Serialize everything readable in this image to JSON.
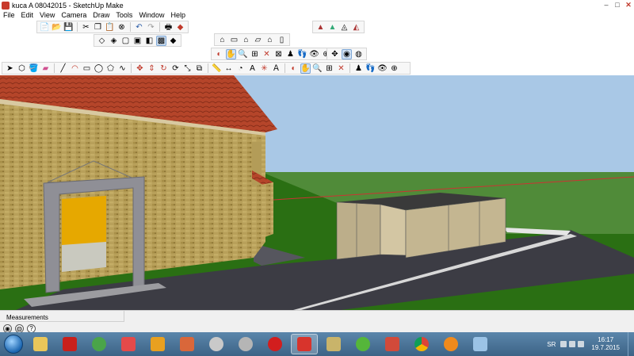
{
  "window": {
    "title": "kuca A 08042015 - SketchUp Make",
    "minimize": "–",
    "maximize": "□",
    "close": "✕"
  },
  "menu": {
    "items": [
      "File",
      "Edit",
      "View",
      "Camera",
      "Draw",
      "Tools",
      "Window",
      "Help"
    ]
  },
  "toolbars": {
    "standard": [
      "new-icon",
      "open-icon",
      "save-icon",
      "cut-icon",
      "copy-icon",
      "paste-icon",
      "erase-icon",
      "undo-icon",
      "redo-icon",
      "print-icon",
      "model-info-icon"
    ],
    "styles_top": [
      "style-xray-icon",
      "style-back-edges-icon",
      "style-wireframe-icon",
      "style-hidden-line-icon",
      "style-shaded-icon",
      "style-textured-icon",
      "style-monochrome-icon"
    ],
    "views": [
      "iso-view-icon",
      "top-view-icon",
      "front-view-icon",
      "right-view-icon",
      "back-view-icon",
      "left-view-icon"
    ],
    "camera": [
      "orbit-icon",
      "pan-icon",
      "zoom-icon",
      "zoom-window-icon",
      "zoom-extents-icon",
      "previous-view-icon",
      "position-camera-icon",
      "walk-icon",
      "look-around-icon",
      "section-plane-icon"
    ],
    "sandbox": [
      "sandbox-a-icon",
      "sandbox-b-icon",
      "sandbox-c-icon",
      "sandbox-d-icon"
    ],
    "main": [
      "select-icon",
      "make-component-icon",
      "paint-bucket-icon",
      "eraser-icon",
      "line-icon",
      "arc-icon",
      "rectangle-icon",
      "circle-icon",
      "polygon-icon",
      "freehand-icon",
      "move-icon",
      "push-pull-icon",
      "rotate-icon",
      "follow-me-icon",
      "scale-icon",
      "offset-icon",
      "tape-measure-icon",
      "dimension-icon",
      "protractor-icon",
      "text-icon",
      "axes-icon",
      "3d-text-icon",
      "orbit-icon",
      "pan-icon",
      "zoom-icon",
      "zoom-window-icon",
      "zoom-extents-icon",
      "position-camera-icon",
      "walk-icon",
      "look-around-icon",
      "section-plane-icon"
    ]
  },
  "status": {
    "measurements_label": "Measurements",
    "icons": [
      "geo-location-icon",
      "credits-icon",
      "help-icon"
    ]
  },
  "taskbar": {
    "apps": [
      "explorer-icon",
      "acrobat-icon",
      "chrome-app-icon",
      "pdf-tool-icon",
      "media-player-icon",
      "image-viewer-icon",
      "globe-icon",
      "dvd-icon",
      "opera-icon",
      "sketchup-icon",
      "notepad-icon",
      "utorrent-icon",
      "pdf-red-icon",
      "chrome-icon",
      "vlc-icon",
      "paint-icon"
    ],
    "active_app": "sketchup-icon",
    "language": "SR",
    "time": "16:17",
    "date": "19.7.2015"
  },
  "colors": {
    "sky": "#a9c8e6",
    "ground": "#1f5e0e",
    "roof": "#b94a2a",
    "brick": "#b39a52",
    "taskbar": "#4a729a"
  }
}
